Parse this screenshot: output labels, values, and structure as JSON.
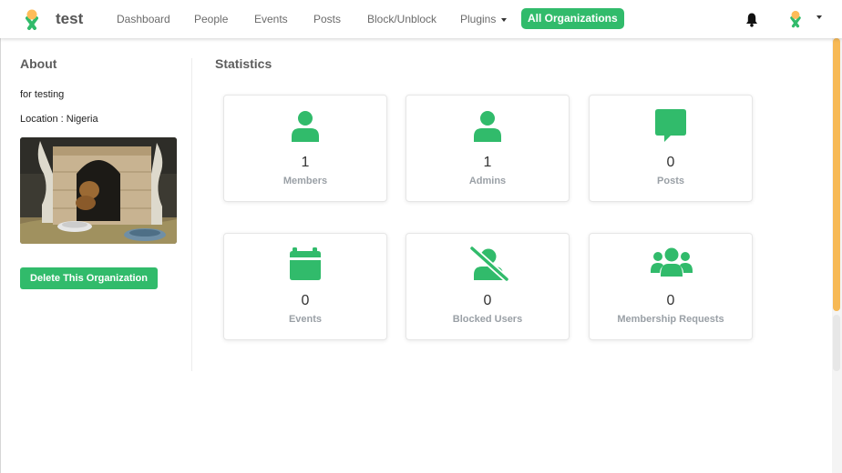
{
  "navbar": {
    "brand": "test",
    "items": [
      {
        "label": "Dashboard"
      },
      {
        "label": "People"
      },
      {
        "label": "Events"
      },
      {
        "label": "Posts"
      },
      {
        "label": "Block/Unblock"
      },
      {
        "label": "Plugins"
      }
    ],
    "active_item": "All Organizations",
    "icons": [
      "talawa-logo-icon",
      "bell-icon",
      "user-avatar-icon",
      "chevron-down-icon"
    ]
  },
  "about": {
    "title": "About",
    "description": "for testing",
    "location": "Location : Nigeria",
    "delete_button": "Delete This Organization"
  },
  "statistics": {
    "title": "Statistics",
    "cards": [
      {
        "icon": "user-icon",
        "value": "1",
        "label": "Members"
      },
      {
        "icon": "user-icon",
        "value": "1",
        "label": "Admins"
      },
      {
        "icon": "comment-icon",
        "value": "0",
        "label": "Posts"
      },
      {
        "icon": "calendar-icon",
        "value": "0",
        "label": "Events"
      },
      {
        "icon": "user-slash-icon",
        "value": "0",
        "label": "Blocked Users"
      },
      {
        "icon": "users-group-icon",
        "value": "0",
        "label": "Membership Requests"
      }
    ]
  },
  "colors": {
    "accent": "#31bb6b",
    "logo_yellow": "#febc59",
    "scrollbar": "#f7b955",
    "label_gray": "#9aa0a6"
  }
}
